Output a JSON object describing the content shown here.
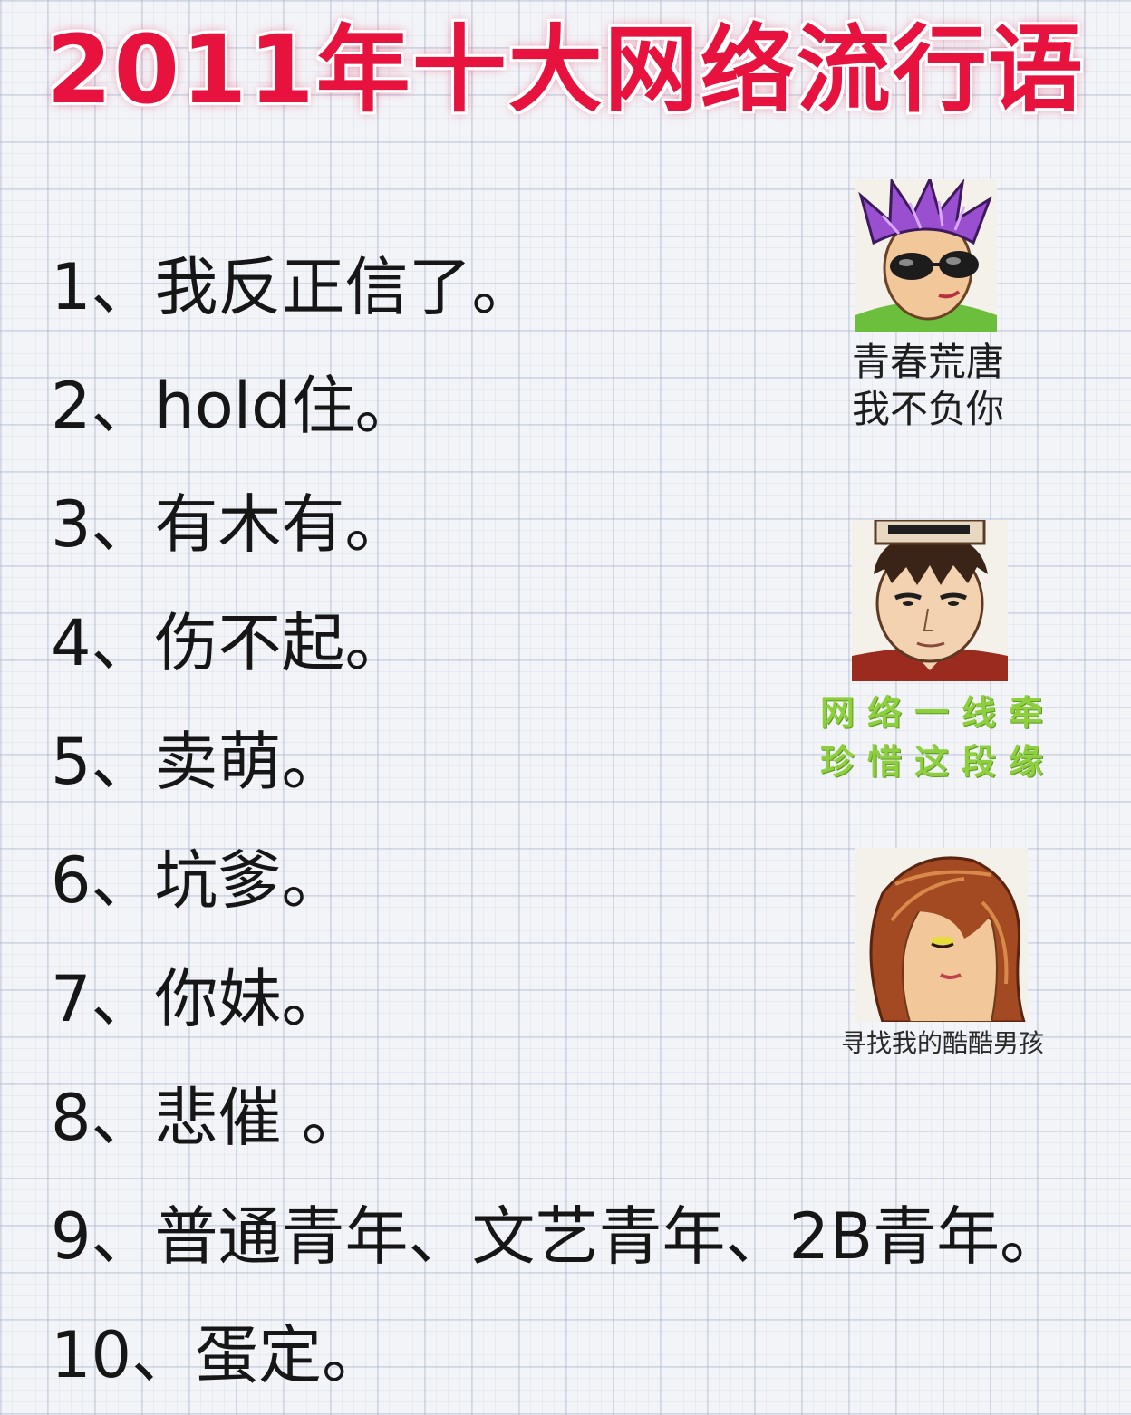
{
  "title": "2011年十大网络流行语",
  "items": [
    "1、我反正信了。",
    "2、hold住。",
    "3、有木有。",
    "4、伤不起。",
    "5、卖萌。",
    "6、坑爹。",
    "7、你妹。",
    "8、悲催 。",
    "9、普通青年、文艺青年、2B青年。",
    "10、蛋定。"
  ],
  "avatars": [
    {
      "icon": "sunglasses-punk-avatar-icon",
      "caption_lines": [
        "青春荒唐",
        "我不负你"
      ]
    },
    {
      "icon": "headband-boy-avatar-icon",
      "caption_lines": [
        "网络一线牵",
        "珍惜这段缘"
      ],
      "caption_color": "#8ecf3d"
    },
    {
      "icon": "long-hair-girl-avatar-icon",
      "caption_lines": [
        "寻找我的酷酷男孩"
      ]
    }
  ],
  "colors": {
    "title": "#e8123f",
    "text": "#161616",
    "background": "#f3f4f8"
  }
}
